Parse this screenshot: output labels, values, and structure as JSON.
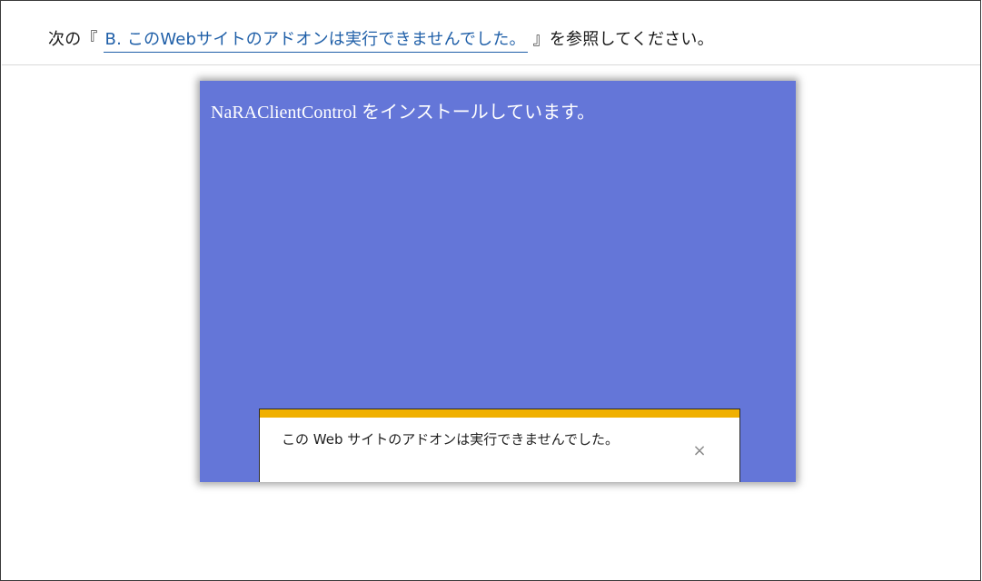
{
  "instruction": {
    "prefix": "次の『",
    "link_text": "B. このWebサイトのアドオンは実行できませんでした。",
    "suffix": "』を参照してください。"
  },
  "screenshot": {
    "install_message": "NaRAClientControl をインストールしています。",
    "notification": {
      "message": "この Web サイトのアドオンは実行できませんでした。",
      "close_symbol": "×",
      "close_icon": "close-icon"
    }
  },
  "colors": {
    "page_bg": "#6476d8",
    "notification_bar": "#f0b000",
    "link": "#1f5fa8"
  }
}
